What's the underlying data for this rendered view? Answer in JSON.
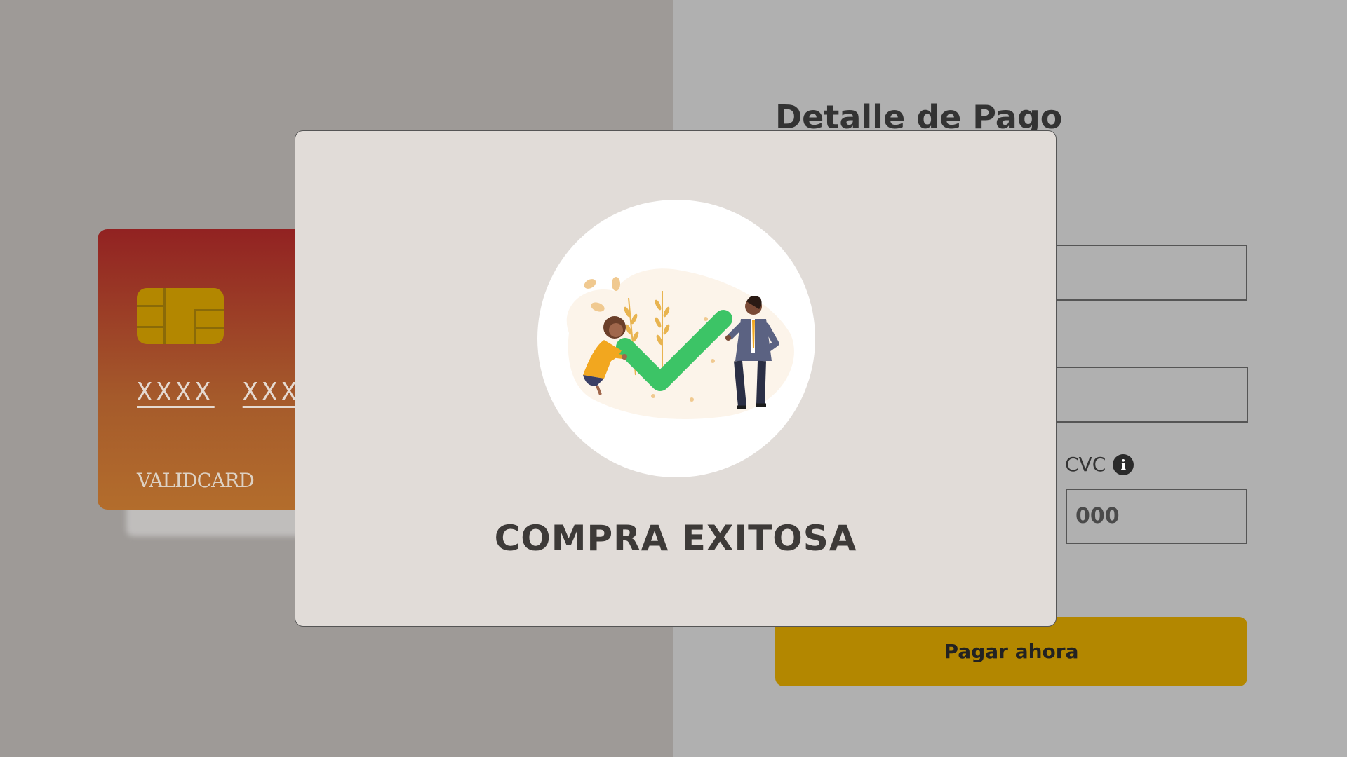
{
  "card": {
    "number_groups": [
      "XXXX",
      "XXXX"
    ],
    "brand": "VALIDCARD"
  },
  "payment_form": {
    "title": "Detalle de Pago",
    "cvc_label": "CVC",
    "cvc_placeholder": "000",
    "pay_button_label": "Pagar ahora"
  },
  "modal": {
    "title": "COMPRA EXITOSA",
    "illustration": "success-checkmark-illustration"
  },
  "colors": {
    "accent": "#b38700",
    "success_green": "#3cc466",
    "card_top": "#922222",
    "card_bottom": "#b36d2c"
  }
}
